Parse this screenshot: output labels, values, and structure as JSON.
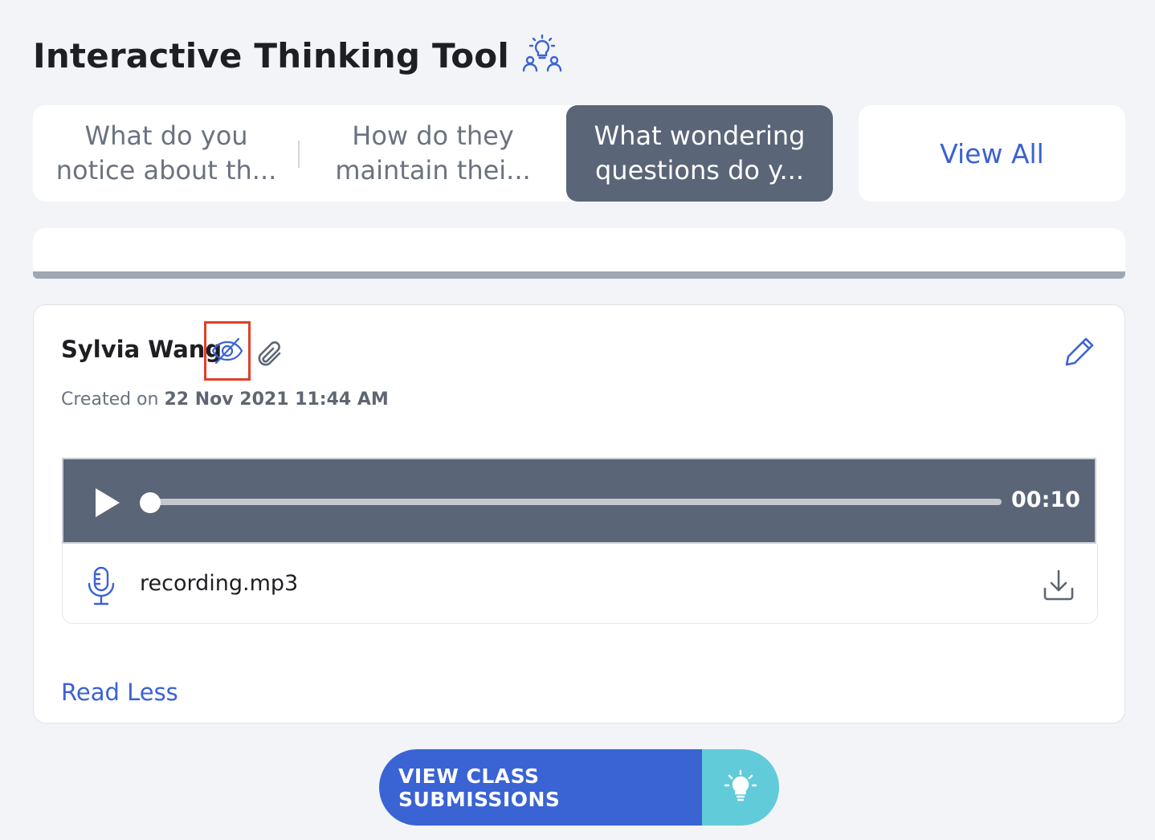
{
  "header": {
    "title": "Interactive Thinking Tool",
    "icon": "group-idea-icon"
  },
  "tabs": [
    {
      "label": "What do you\nnotice about th...",
      "active": false
    },
    {
      "label": "How do they\nmaintain thei...",
      "active": false
    },
    {
      "label": "What wondering\nquestions do y...",
      "active": true
    }
  ],
  "view_all_label": "View All",
  "submission": {
    "author": "Sylvia Wang",
    "created_prefix": "Created on",
    "created_date": "22 Nov 2021 11:44 AM",
    "audio": {
      "time": "00:10",
      "progress": 0
    },
    "file_name": "recording.mp3",
    "read_less_label": "Read Less"
  },
  "footer": {
    "view_class_submissions_label": "VIEW CLASS SUBMISSIONS"
  },
  "colors": {
    "accent": "#3a63d4",
    "tab_active": "#5a6577",
    "bulb_bg": "#62cbd9",
    "highlight": "#e0402a"
  }
}
